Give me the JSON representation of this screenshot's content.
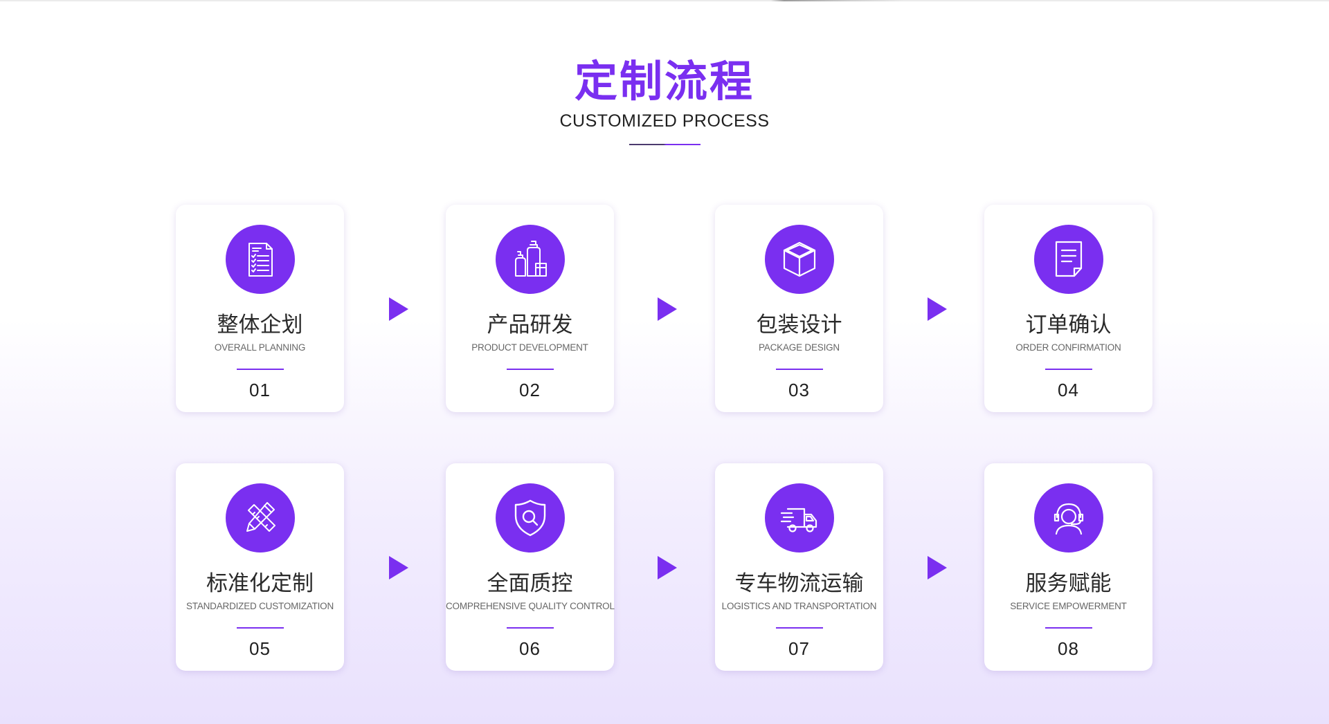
{
  "header": {
    "title": "定制流程",
    "subtitle": "CUSTOMIZED PROCESS"
  },
  "steps": [
    {
      "title": "整体企划",
      "subtitle": "OVERALL PLANNING",
      "number": "01",
      "icon": "checklist-icon"
    },
    {
      "title": "产品研发",
      "subtitle": "PRODUCT DEVELOPMENT",
      "number": "02",
      "icon": "bottles-icon"
    },
    {
      "title": "包装设计",
      "subtitle": "PACKAGE DESIGN",
      "number": "03",
      "icon": "box-icon"
    },
    {
      "title": "订单确认",
      "subtitle": "ORDER CONFIRMATION",
      "number": "04",
      "icon": "document-icon"
    },
    {
      "title": "标准化定制",
      "subtitle": "STANDARDIZED CUSTOMIZATION",
      "number": "05",
      "icon": "pencil-ruler-icon"
    },
    {
      "title": "全面质控",
      "subtitle": "COMPREHENSIVE QUALITY CONTROL",
      "number": "06",
      "icon": "shield-search-icon"
    },
    {
      "title": "专车物流运输",
      "subtitle": "LOGISTICS AND TRANSPORTATION",
      "number": "07",
      "icon": "truck-icon"
    },
    {
      "title": "服务赋能",
      "subtitle": "SERVICE EMPOWERMENT",
      "number": "08",
      "icon": "headset-icon"
    }
  ],
  "colors": {
    "accent": "#7a2ff0",
    "text": "#2a2a2a",
    "background_bottom": "#e9e1fd"
  }
}
